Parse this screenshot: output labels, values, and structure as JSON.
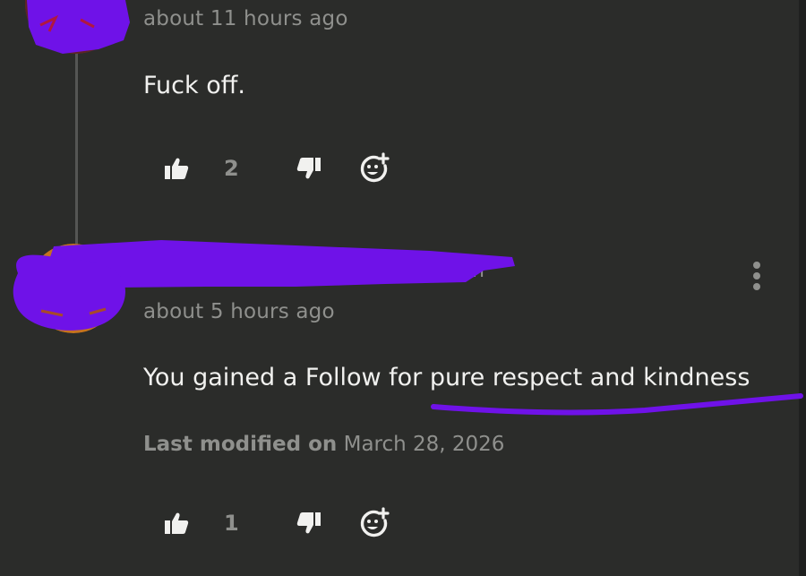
{
  "comments": [
    {
      "timestamp": "about 11 hours ago",
      "body": "Fuck off.",
      "likes": "2",
      "icons": {
        "like": "thumbs-up-icon",
        "dislike": "thumbs-down-icon",
        "react": "add-reaction-icon"
      }
    },
    {
      "author_visible_fragment": "n",
      "timestamp": "about 5 hours ago",
      "body": "You gained a Follow for pure respect and kindness",
      "modified_label": "Last modified on",
      "modified_date": "March 28, 2026",
      "likes": "1",
      "icons": {
        "like": "thumbs-up-icon",
        "dislike": "thumbs-down-icon",
        "react": "add-reaction-icon",
        "menu": "more-vertical-icon"
      }
    }
  ],
  "colors": {
    "background": "#2b2c2a",
    "text": "#f1f1ef",
    "muted": "#8f908d",
    "annotation": "#6f12e8"
  }
}
